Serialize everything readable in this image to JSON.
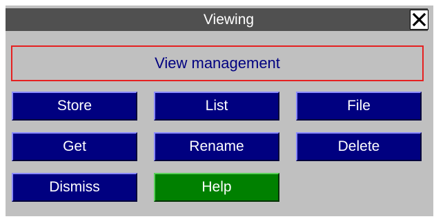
{
  "window": {
    "title": "Viewing"
  },
  "banner": {
    "label": "View management"
  },
  "buttons": {
    "store": "Store",
    "list": "List",
    "file": "File",
    "get": "Get",
    "rename": "Rename",
    "delete": "Delete",
    "dismiss": "Dismiss",
    "help": "Help"
  },
  "icons": {
    "close": "close-icon"
  },
  "colors": {
    "window_bg": "#c0c0c0",
    "titlebar_bg": "#505050",
    "button_blue": "#000080",
    "button_green": "#008000",
    "banner_border": "#e52020",
    "banner_text": "#000080"
  }
}
